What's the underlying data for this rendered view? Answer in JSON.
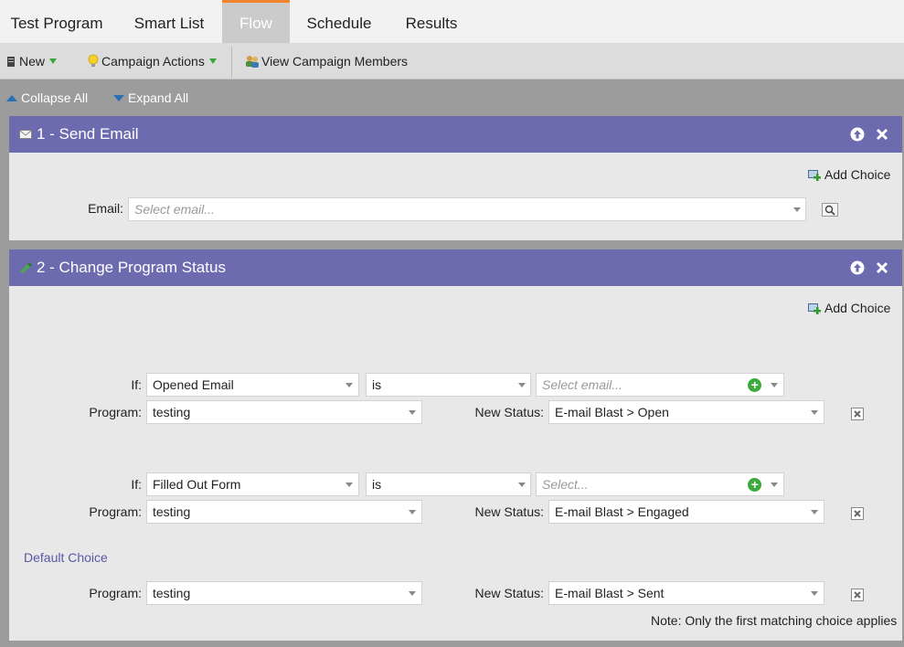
{
  "tabs": [
    {
      "label": "Test Program"
    },
    {
      "label": "Smart List"
    },
    {
      "label": "Flow"
    },
    {
      "label": "Schedule"
    },
    {
      "label": "Results"
    }
  ],
  "toolbar": {
    "new_label": "New",
    "campaign_actions_label": "Campaign Actions",
    "view_members_label": "View Campaign Members"
  },
  "subbar": {
    "collapse_label": "Collapse All",
    "expand_label": "Expand All"
  },
  "step1": {
    "title": "1 - Send Email",
    "add_choice": "Add Choice",
    "email_label": "Email:",
    "email_placeholder": "Select email..."
  },
  "step2": {
    "title": "2 - Change Program Status",
    "add_choice": "Add Choice",
    "choices": [
      {
        "if_label": "If:",
        "if_value": "Opened Email",
        "operator": "is",
        "target_placeholder": "Select email...",
        "program_label": "Program:",
        "program_value": "testing",
        "status_label": "New Status:",
        "status_value": "E-mail Blast > Open"
      },
      {
        "if_label": "If:",
        "if_value": "Filled Out Form",
        "operator": "is",
        "target_placeholder": "Select...",
        "program_label": "Program:",
        "program_value": "testing",
        "status_label": "New Status:",
        "status_value": "E-mail Blast > Engaged"
      }
    ],
    "default_choice_label": "Default Choice",
    "default": {
      "program_label": "Program:",
      "program_value": "testing",
      "status_label": "New Status:",
      "status_value": "E-mail Blast > Sent"
    },
    "note": "Note: Only the first matching choice applies"
  },
  "colors": {
    "header_purple": "#6d6bb0",
    "active_tab_accent": "#f0842c",
    "add_green": "#3caa3c",
    "link_purple": "#5a58a8"
  }
}
